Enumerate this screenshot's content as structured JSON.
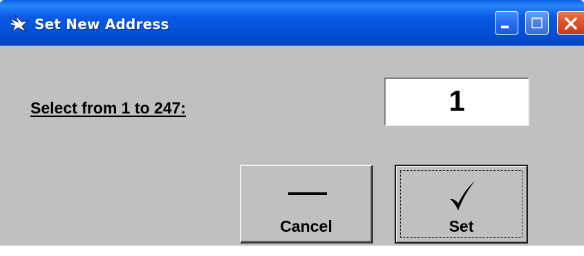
{
  "window": {
    "title": "Set New Address",
    "app_icon": "app-icon",
    "controls": {
      "minimize_icon": "minimize-icon",
      "maximize_icon": "maximize-icon",
      "close_icon": "close-icon"
    }
  },
  "form": {
    "prompt": "Select from 1 to 247:",
    "value": "1"
  },
  "buttons": {
    "cancel": {
      "label": "Cancel",
      "icon": "dash-icon"
    },
    "set": {
      "label": "Set",
      "icon": "checkmark-icon"
    }
  },
  "colors": {
    "titlebar": "#0a5ce8",
    "client": "#c0c0c0",
    "close": "#e0502a"
  }
}
